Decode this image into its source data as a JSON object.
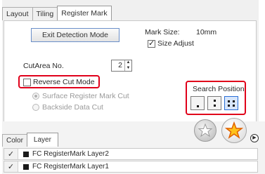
{
  "tabs": [
    {
      "label": "Layout"
    },
    {
      "label": "Tiling"
    },
    {
      "label": "Register Mark"
    }
  ],
  "register_mark": {
    "exit_button": "Exit Detection Mode",
    "mark_size_label": "Mark Size:",
    "mark_size_value": "10mm",
    "size_adjust_label": "Size Adjust",
    "size_adjust_checked": true,
    "cutarea_label": "CutArea No.",
    "cutarea_value": "2",
    "reverse_cut_label": "Reverse Cut Mode",
    "reverse_cut_checked": false,
    "surface_option": "Surface Register Mark Cut",
    "backside_option": "Backside Data Cut",
    "search_position_label": "Search Position",
    "search_position_selected": 3
  },
  "bottom": {
    "tabs": [
      {
        "label": "Color"
      },
      {
        "label": "Layer"
      }
    ],
    "layers": [
      {
        "name": "FC RegisterMark Layer2",
        "checked": true
      },
      {
        "name": "FC RegisterMark Layer1",
        "checked": true
      }
    ]
  },
  "colors": {
    "highlight": "#e0001a",
    "accent": "#2b6fd6"
  }
}
